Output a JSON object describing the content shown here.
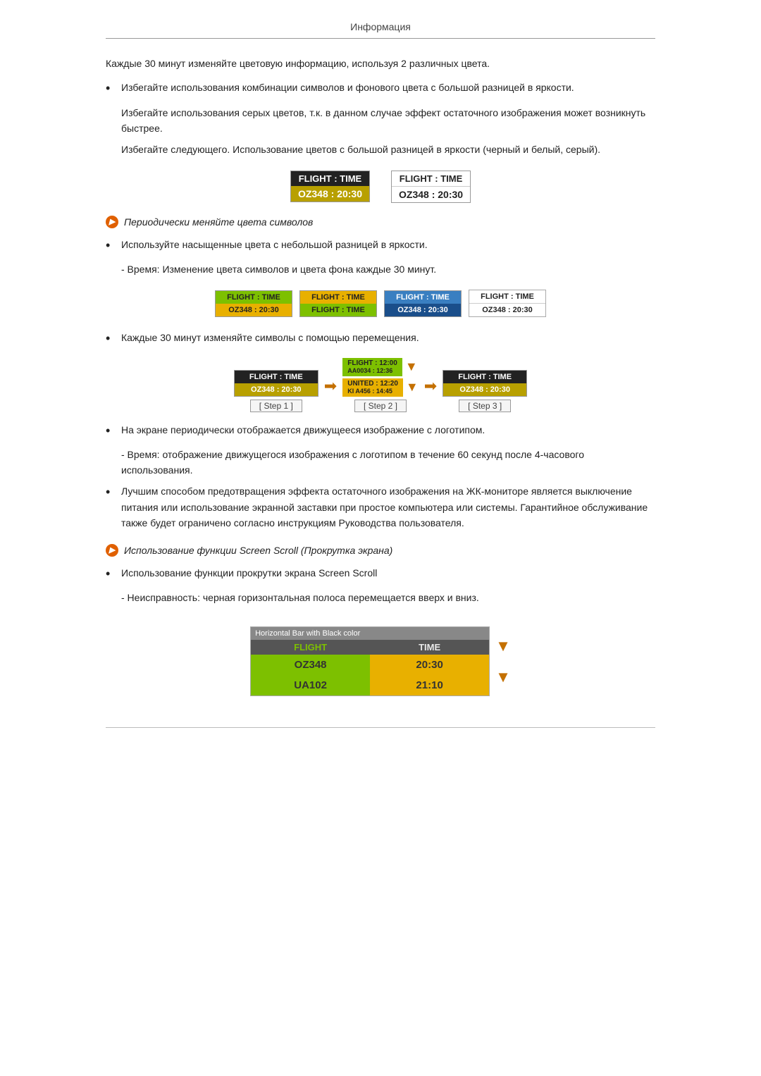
{
  "header": {
    "title": "Информация"
  },
  "intro_text": "Каждые 30 минут изменяйте цветовую информацию, используя 2 различных цвета.",
  "bullet1": {
    "text": "Избегайте использования комбинации символов и фонового цвета с большой разницей в яркости."
  },
  "sub1a": "Избегайте использования серых цветов, т.к. в данном случае эффект остаточного изображения может возникнуть быстрее.",
  "sub1b": "Избегайте следующего. Использование цветов с большой разницей в яркости (черный и белый, серый).",
  "diagram1": {
    "box1_r1": "FLIGHT  :  TIME",
    "box1_r2": "OZ348   :  20:30",
    "box2_r1": "FLIGHT  :  TIME",
    "box2_r2": "OZ348   :  20:30"
  },
  "section2_header": "Периодически меняйте цвета символов",
  "bullet2": {
    "text": "Используйте насыщенные цвета с небольшой разницей в яркости."
  },
  "sub2a": "- Время: Изменение цвета символов и цвета фона каждые 30 минут.",
  "diagram2": {
    "boxes": [
      {
        "r1": "FLIGHT : TIME",
        "r2": "OZ348 : 20:30",
        "style": "green"
      },
      {
        "r1": "FLIGHT : TIME",
        "r2": "FLIGHT : TIME",
        "style": "yellow"
      },
      {
        "r1": "FLIGHT : TIME",
        "r2": "OZ348 : 20:30",
        "style": "blue"
      },
      {
        "r1": "FLIGHT : TIME",
        "r2": "OZ348 : 20:30",
        "style": "white"
      }
    ]
  },
  "bullet3": {
    "text": "Каждые 30 минут изменяйте символы с помощью перемещения."
  },
  "step_diagram": {
    "step1_label": "[ Step 1 ]",
    "step2_label": "[ Step 2 ]",
    "step3_label": "[ Step 3 ]",
    "step1_r1": "FLIGHT : TIME",
    "step1_r2": "OZ348  : 20:30",
    "step2_row1a": "FLIGHT : 12:00",
    "step2_row1b": "AA0034 : 12:36",
    "step2_row2a": "UNITED : 12:20",
    "step2_row2b": "KI A456 : 14:45",
    "step3_r1": "FLIGHT : TIME",
    "step3_r2": "OZ348  : 20:30"
  },
  "bullet4": {
    "text": "На экране периодически отображается движущееся изображение с логотипом."
  },
  "sub4a": "- Время: отображение движущегося изображения с логотипом в течение 60 секунд после 4-часового использования.",
  "bullet5": {
    "text": "Лучшим способом предотвращения эффекта остаточного изображения на ЖК-мониторе является выключение питания или использование экранной заставки при простое компьютера или системы. Гарантийное обслуживание также будет ограничено согласно инструкциям Руководства пользователя."
  },
  "section3_header": "Использование функции Screen Scroll (Прокрутка экрана)",
  "bullet6": {
    "text": "Использование функции прокрутки экрана Screen Scroll"
  },
  "sub6a": "- Неисправность: черная горизонтальная полоса перемещается вверх и вниз.",
  "scroll_diagram": {
    "header_left": "Horizontal Bar with Black color",
    "col1_header": "FLIGHT",
    "col2_header": "TIME",
    "row1_col1": "OZ348",
    "row1_col2": "20:30",
    "row2_col1": "UA102",
    "row2_col2": "21:10"
  }
}
